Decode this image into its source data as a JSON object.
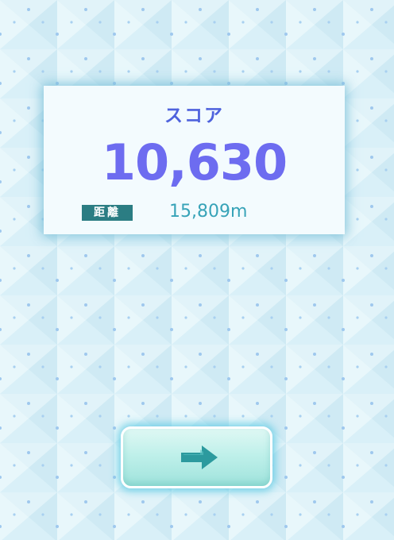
{
  "result": {
    "score_label": "スコア",
    "score_value": "10,630",
    "distance_label": "距離",
    "distance_value": "15,809m"
  },
  "next_button": {
    "icon": "right-arrow-icon"
  },
  "colors": {
    "background": "#d9f0f8",
    "pattern_dot": "#9fc8ee",
    "card_background": "#f3fbfe",
    "score_label": "#4f63dd",
    "score_value": "#6d6cf0",
    "badge_background": "#2b7d83",
    "distance_value": "#37a3b8",
    "button_face": "#bff0ea",
    "arrow": "#2c9a9e"
  }
}
